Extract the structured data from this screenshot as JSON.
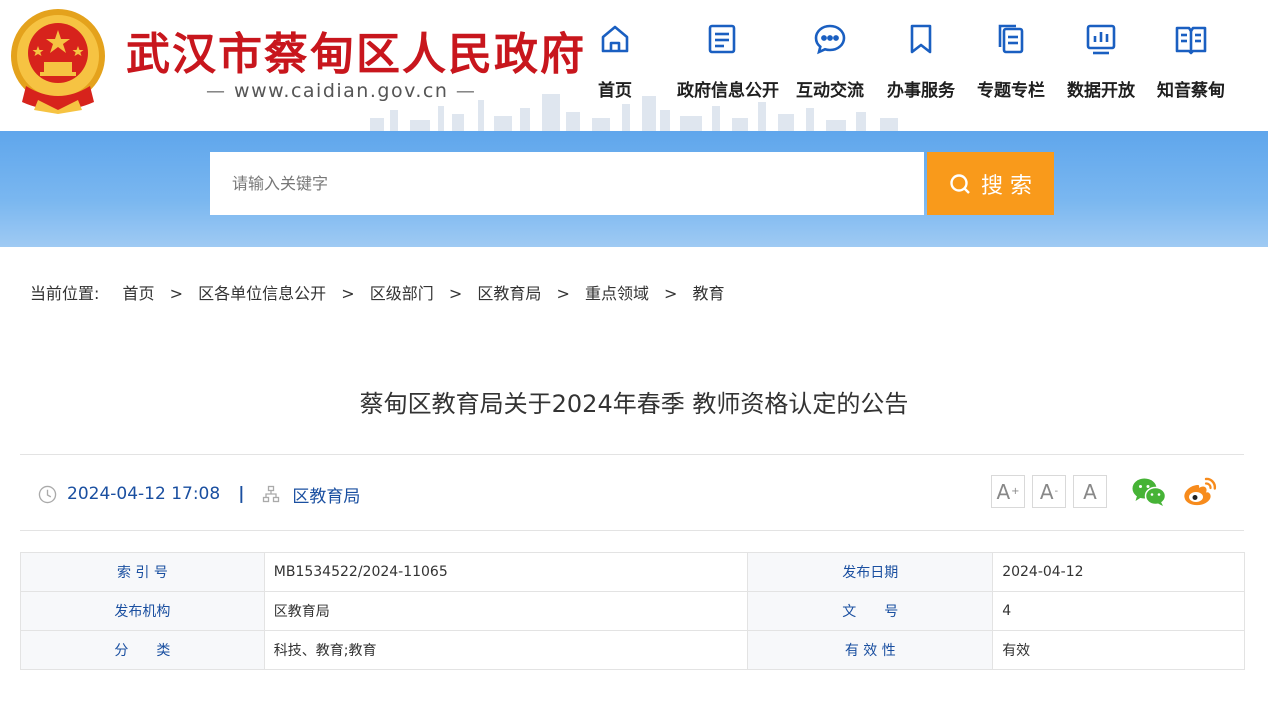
{
  "site": {
    "title": "武汉市蔡甸区人民政府",
    "url": "www.caidian.gov.cn",
    "url_dash_left": "—",
    "url_dash_right": "—",
    "brand_red": "#c8161d"
  },
  "nav": {
    "items": [
      {
        "label": "首页",
        "icon": "home-icon"
      },
      {
        "label": "政府信息公开",
        "icon": "document-icon"
      },
      {
        "label": "互动交流",
        "icon": "chat-bubble-icon"
      },
      {
        "label": "办事服务",
        "icon": "bookmark-icon"
      },
      {
        "label": "专题专栏",
        "icon": "files-icon"
      },
      {
        "label": "数据开放",
        "icon": "bar-chart-icon"
      },
      {
        "label": "知音蔡甸",
        "icon": "open-book-icon"
      }
    ],
    "icon_color": "#1a5fc1"
  },
  "search": {
    "placeholder": "请输入关键字",
    "button_label": "搜 索",
    "button_color": "#f99a1b"
  },
  "breadcrumb": {
    "label": "当前位置:",
    "separator": ">",
    "items": [
      "首页",
      "区各单位信息公开",
      "区级部门",
      "区教育局",
      "重点领域",
      "教育"
    ]
  },
  "article": {
    "title": "蔡甸区教育局关于2024年春季 教师资格认定的公告",
    "datetime": "2024-04-12 17:08",
    "pipe": "|",
    "publisher": "区教育局",
    "font_buttons": {
      "larger": "A",
      "larger_sup": "+",
      "smaller": "A",
      "smaller_sup": "-",
      "reset": "A"
    },
    "share": [
      "wechat-icon",
      "weibo-icon"
    ]
  },
  "info": {
    "rows": [
      {
        "k1": "索 引 号",
        "v1": "MB1534522/2024-11065",
        "k2": "发布日期",
        "v2": "2024-04-12"
      },
      {
        "k1": "发布机构",
        "v1": "区教育局",
        "k2": "文　　号",
        "v2": "4"
      },
      {
        "k1": "分　　类",
        "v1": "科技、教育;教育",
        "k2": "有 效 性",
        "v2": "有效"
      }
    ]
  }
}
